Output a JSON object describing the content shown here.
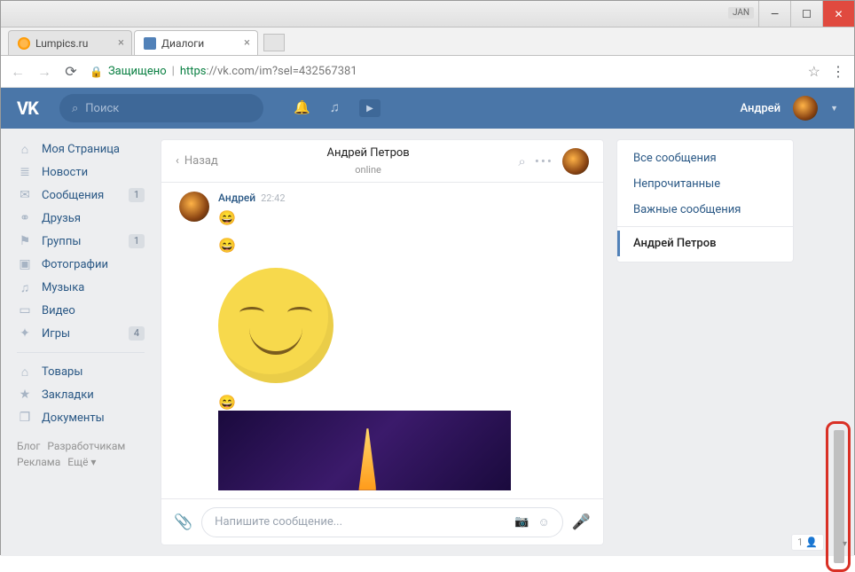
{
  "window": {
    "jan": "JAN"
  },
  "tabs": [
    {
      "title": "Lumpics.ru"
    },
    {
      "title": "Диалоги"
    }
  ],
  "address": {
    "secure": "Защищено",
    "proto": "https",
    "host": "://vk.com",
    "path": "/im?sel=432567381"
  },
  "header": {
    "search_placeholder": "Поиск",
    "username": "Андрей"
  },
  "nav": {
    "items": [
      {
        "label": "Моя Страница",
        "icon": "⌂"
      },
      {
        "label": "Новости",
        "icon": "≣"
      },
      {
        "label": "Сообщения",
        "icon": "✉",
        "badge": "1"
      },
      {
        "label": "Друзья",
        "icon": "⚭"
      },
      {
        "label": "Группы",
        "icon": "⚑",
        "badge": "1"
      },
      {
        "label": "Фотографии",
        "icon": "▣"
      },
      {
        "label": "Музыка",
        "icon": "♫"
      },
      {
        "label": "Видео",
        "icon": "▭"
      },
      {
        "label": "Игры",
        "icon": "✦",
        "badge": "4"
      }
    ],
    "items2": [
      {
        "label": "Товары",
        "icon": "⌂"
      },
      {
        "label": "Закладки",
        "icon": "★"
      },
      {
        "label": "Документы",
        "icon": "❐"
      }
    ],
    "footer": {
      "blog": "Блог",
      "dev": "Разработчикам",
      "ads": "Реклама",
      "more": "Ещё ▾"
    }
  },
  "chat": {
    "back": "Назад",
    "peer_name": "Андрей Петров",
    "peer_status": "online",
    "message": {
      "sender": "Андрей",
      "time": "22:42"
    },
    "composer_placeholder": "Напишите сообщение..."
  },
  "filters": {
    "all": "Все сообщения",
    "unread": "Непрочитанные",
    "important": "Важные сообщения",
    "active": "Андрей Петров"
  },
  "bottom": {
    "count": "1"
  }
}
